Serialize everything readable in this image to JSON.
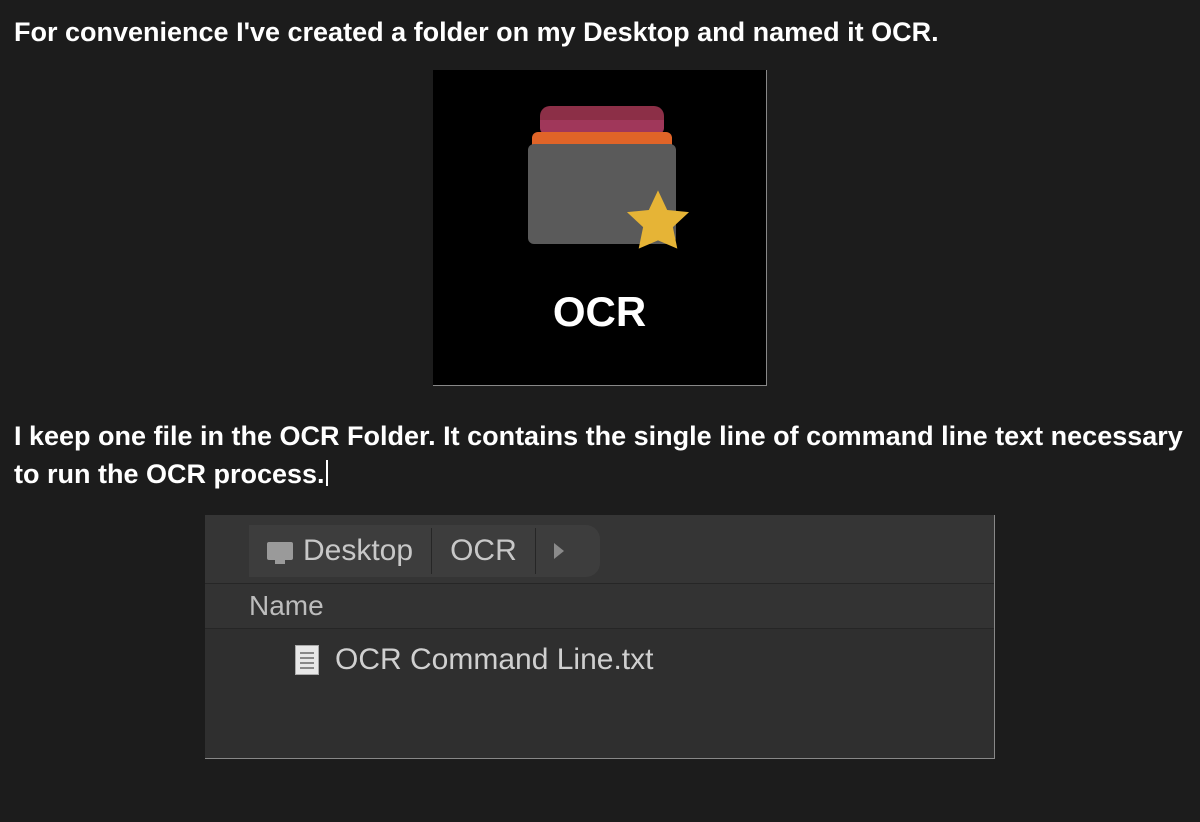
{
  "para1": "For convenience I've created a folder on my Desktop and named it OCR.",
  "tile": {
    "label": "OCR"
  },
  "para2": "I keep one file in the OCR Folder.  It contains the single line of command line text necessary to run the OCR process.",
  "fileManager": {
    "breadcrumb": {
      "root": "Desktop",
      "current": "OCR"
    },
    "columnHeader": "Name",
    "fileName": "OCR Command Line.txt"
  }
}
